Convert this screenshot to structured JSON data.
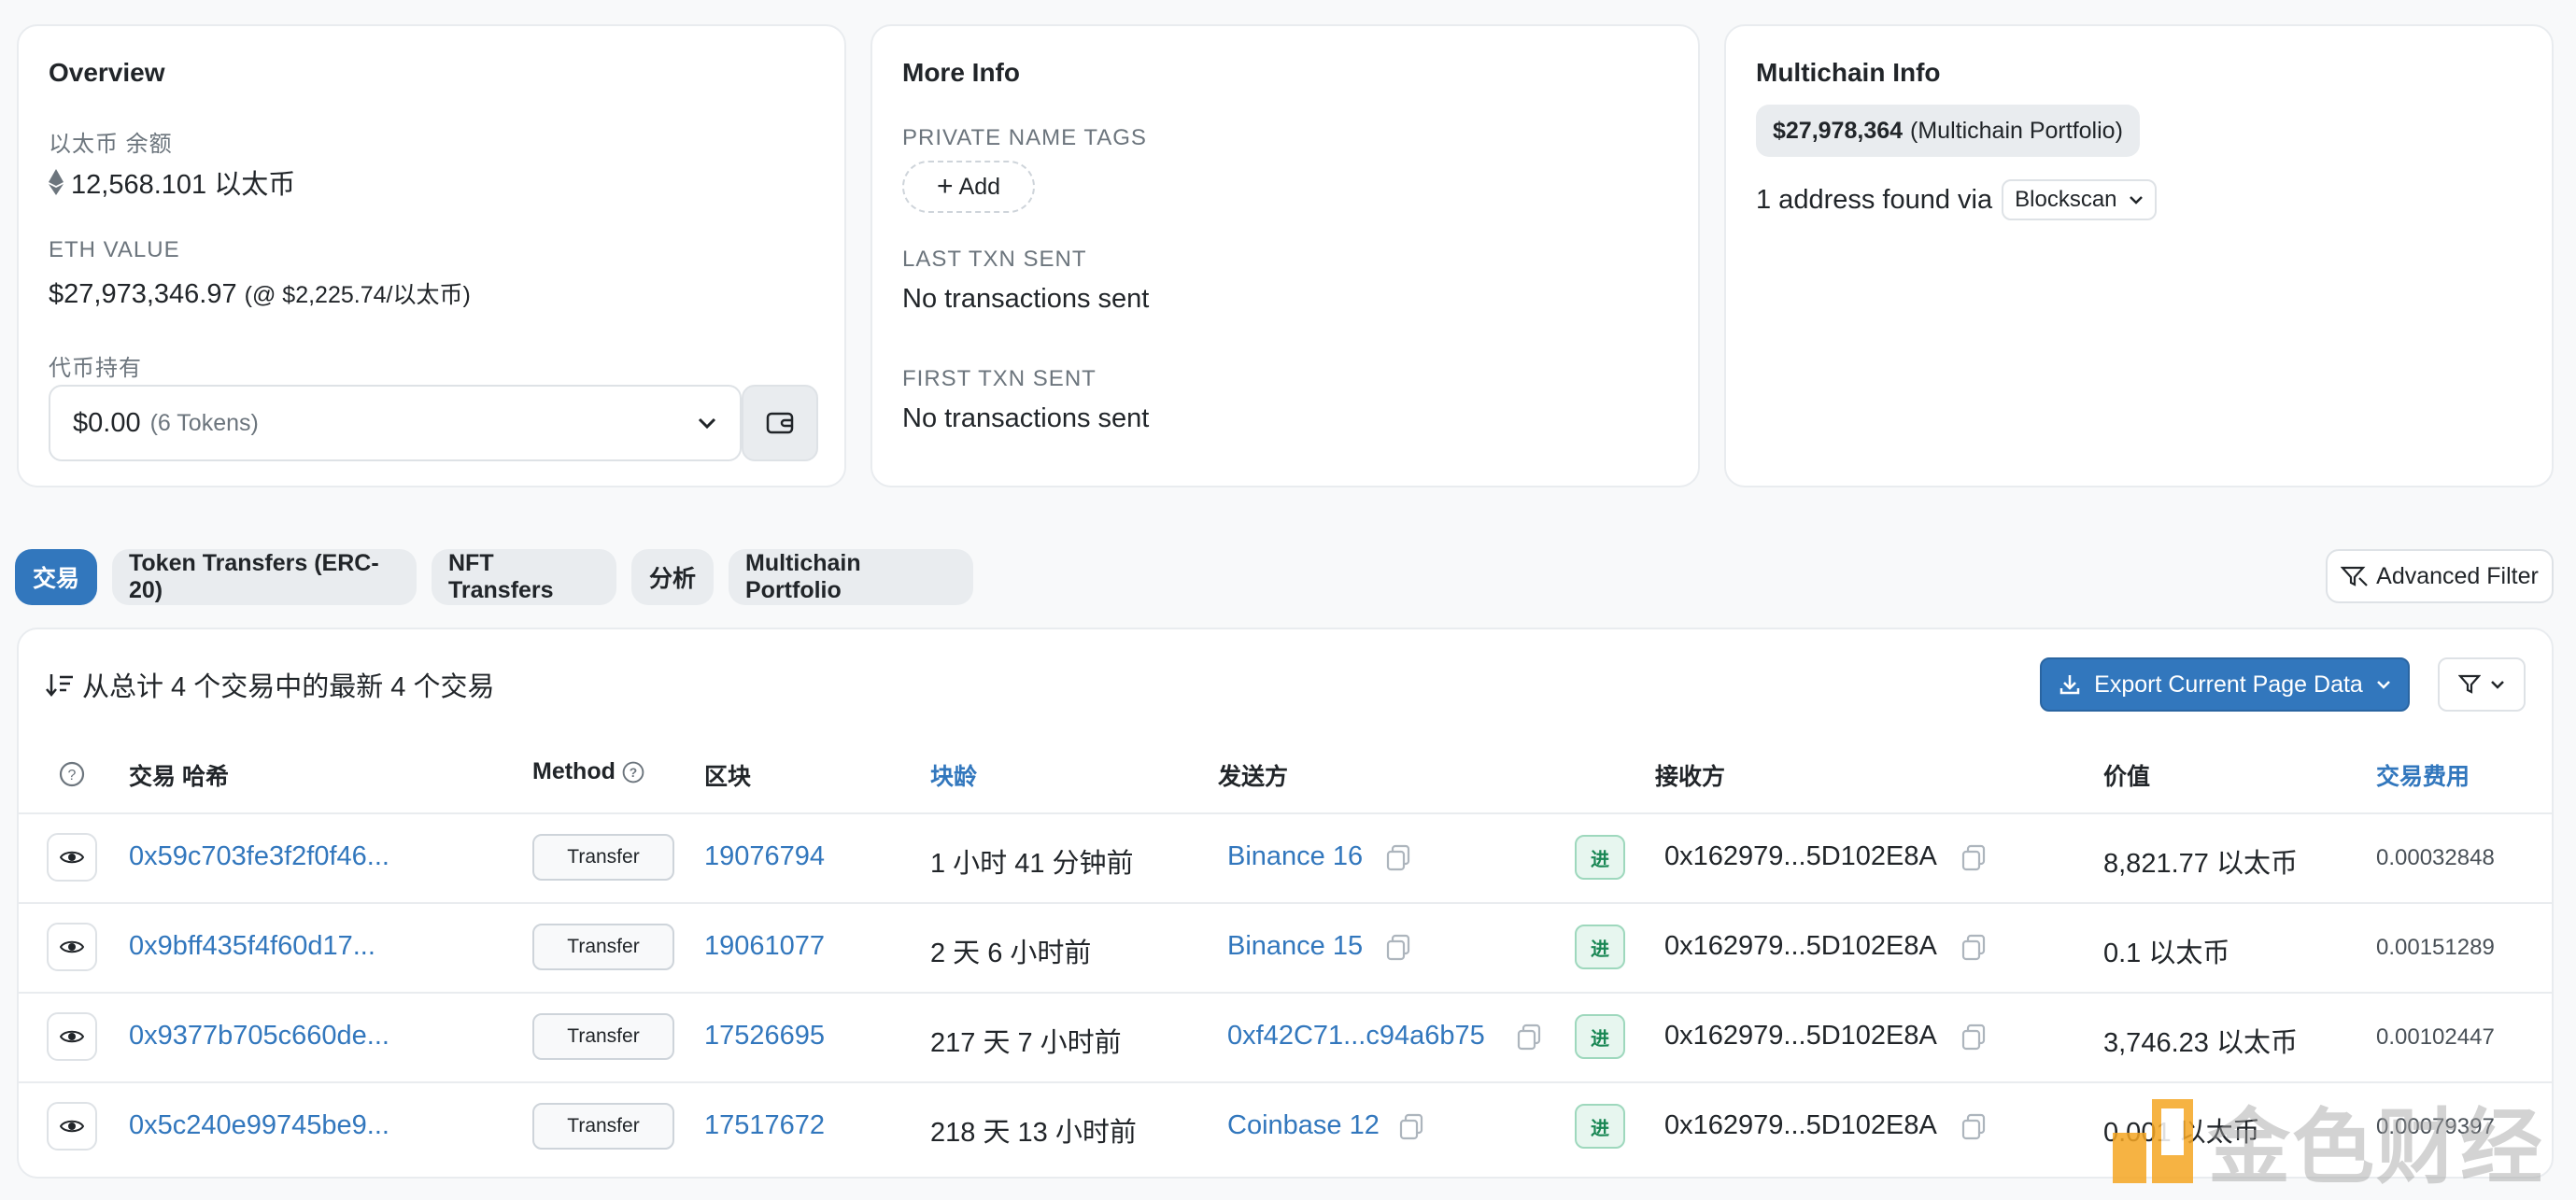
{
  "overview": {
    "title": "Overview",
    "balance_label": "以太币 余额",
    "balance_value": "12,568.101 以太币",
    "eth_value_label": "ETH VALUE",
    "eth_value": "$27,973,346.97",
    "eth_price": "(@ $2,225.74/以太币)",
    "token_holdings_label": "代币持有",
    "token_amount": "$0.00",
    "token_count": "(6 Tokens)"
  },
  "more_info": {
    "title": "More Info",
    "private_tags_label": "PRIVATE NAME TAGS",
    "add_label": "Add",
    "last_txn_label": "LAST TXN SENT",
    "last_txn_value": "No transactions sent",
    "first_txn_label": "FIRST TXN SENT",
    "first_txn_value": "No transactions sent"
  },
  "multichain": {
    "title": "Multichain Info",
    "portfolio_amount": "$27,978,364",
    "portfolio_label": "(Multichain Portfolio)",
    "address_found": "1 address found via",
    "blockscan_label": "Blockscan"
  },
  "tabs": [
    {
      "label": "交易",
      "active": true
    },
    {
      "label": "Token Transfers (ERC-20)",
      "active": false
    },
    {
      "label": "NFT Transfers",
      "active": false
    },
    {
      "label": "分析",
      "active": false
    },
    {
      "label": "Multichain Portfolio",
      "active": false
    }
  ],
  "advanced_filter_label": "Advanced Filter",
  "table": {
    "summary": "从总计 4 个交易中的最新 4 个交易",
    "export_label": "Export Current Page Data",
    "headers": {
      "hash": "交易 哈希",
      "method": "Method",
      "block": "区块",
      "age": "块龄",
      "from": "发送方",
      "to": "接收方",
      "value": "价值",
      "fee": "交易费用"
    },
    "rows": [
      {
        "hash": "0x59c703fe3f2f0f46...",
        "method": "Transfer",
        "block": "19076794",
        "age": "1 小时 41 分钟前",
        "from": "Binance 16",
        "direction": "进",
        "to": "0x162979...5D102E8A",
        "value": "8,821.77 以太币",
        "fee": "0.00032848"
      },
      {
        "hash": "0x9bff435f4f60d17...",
        "method": "Transfer",
        "block": "19061077",
        "age": "2 天 6 小时前",
        "from": "Binance 15",
        "direction": "进",
        "to": "0x162979...5D102E8A",
        "value": "0.1 以太币",
        "fee": "0.00151289"
      },
      {
        "hash": "0x9377b705c660de...",
        "method": "Transfer",
        "block": "17526695",
        "age": "217 天 7 小时前",
        "from": "0xf42C71...c94a6b75",
        "direction": "进",
        "to": "0x162979...5D102E8A",
        "value": "3,746.23 以太币",
        "fee": "0.00102447"
      },
      {
        "hash": "0x5c240e99745be9...",
        "method": "Transfer",
        "block": "17517672",
        "age": "218 天 13 小时前",
        "from": "Coinbase 12",
        "direction": "进",
        "to": "0x162979...5D102E8A",
        "value": "0.001 以太币",
        "fee": "0.00079397"
      }
    ]
  },
  "watermark": "金色财经",
  "colors": {
    "accent": "#3277bd",
    "in_badge": "#198754"
  }
}
